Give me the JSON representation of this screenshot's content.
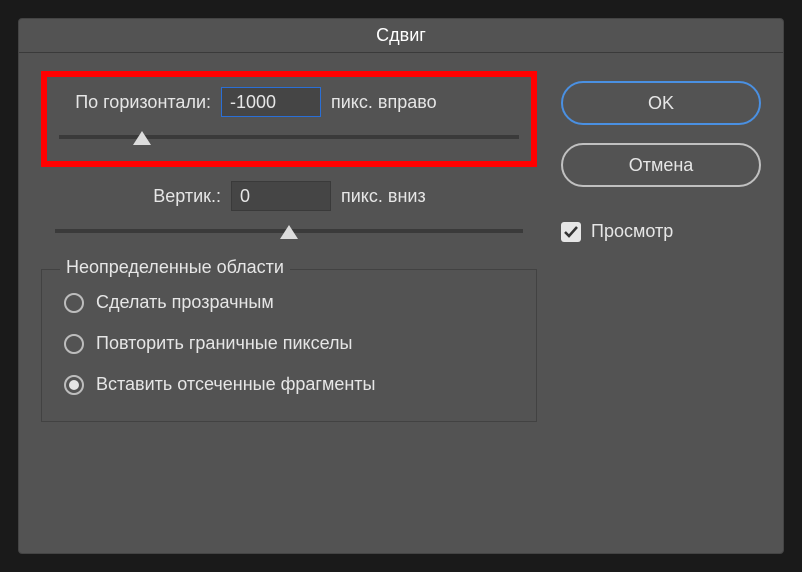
{
  "dialog": {
    "title": "Сдвиг"
  },
  "horizontal": {
    "label": "По горизонтали:",
    "value": "-1000",
    "unit": "пикс. вправо",
    "slider_percent": 18
  },
  "vertical": {
    "label": "Вертик.:",
    "value": "0",
    "unit": "пикс. вниз",
    "slider_percent": 50
  },
  "buttons": {
    "ok": "OK",
    "cancel": "Отмена"
  },
  "preview": {
    "label": "Просмотр",
    "checked": true
  },
  "undefined_areas": {
    "legend": "Неопределенные области",
    "options": {
      "transparent": "Сделать прозрачным",
      "repeat_edge": "Повторить граничные пикселы",
      "wrap": "Вставить отсеченные фрагменты"
    },
    "selected": "wrap"
  }
}
